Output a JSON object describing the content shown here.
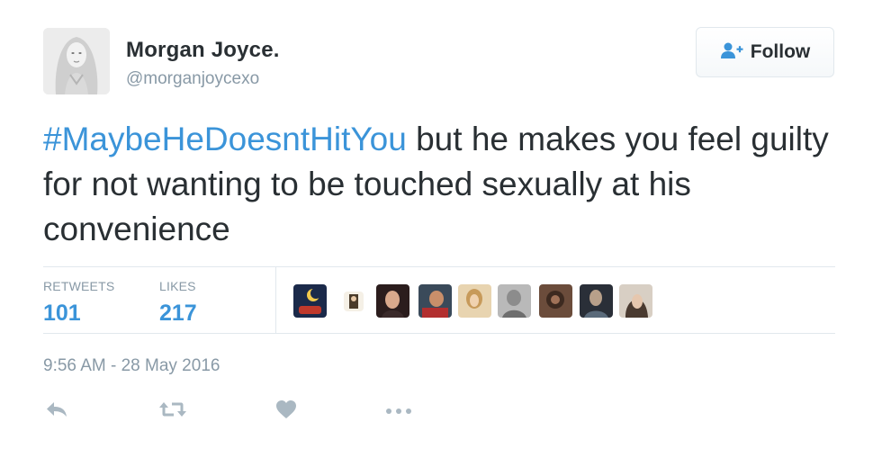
{
  "user": {
    "name": "Morgan Joyce.",
    "handle": "@morganjoycexo"
  },
  "follow_button": {
    "label": "Follow",
    "icon": "add-user-icon"
  },
  "tweet": {
    "hashtag": "#MaybeHeDoesntHitYou",
    "body": " but he makes you feel guilty for not wanting to be touched sexually at his convenience"
  },
  "stats": {
    "retweets_label": "RETWEETS",
    "retweets_count": "101",
    "likes_label": "LIKES",
    "likes_count": "217"
  },
  "liker_avatars_count": 9,
  "timestamp": "9:56 AM - 28 May 2016",
  "actions": [
    "reply-icon",
    "retweet-icon",
    "like-icon",
    "more-icon"
  ],
  "colors": {
    "link": "#3b94d9",
    "muted": "#8899a6",
    "text": "#292f33",
    "border": "#e1e8ed"
  }
}
